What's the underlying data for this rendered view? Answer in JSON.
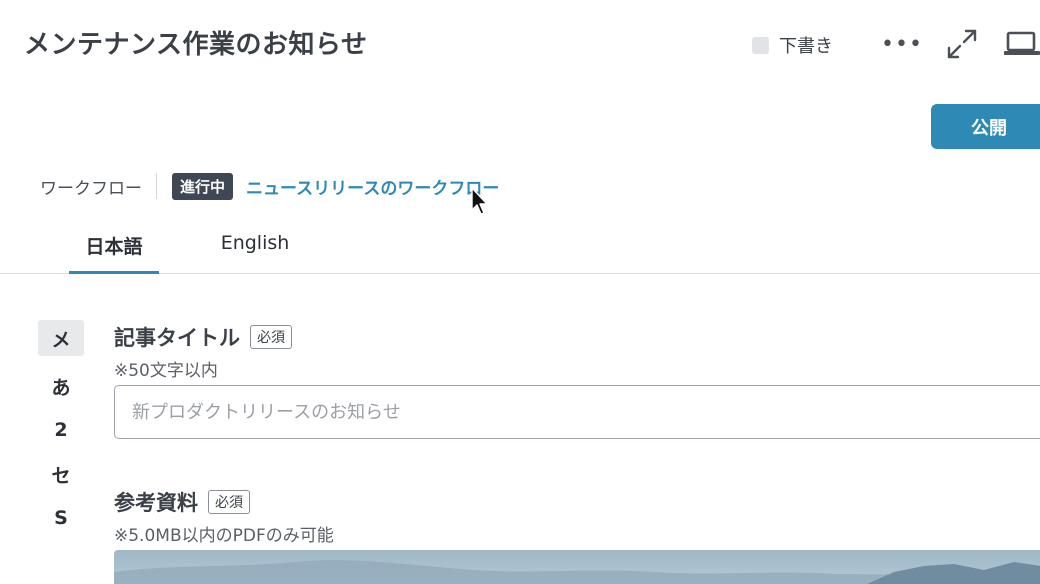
{
  "header": {
    "title": "メンテナンス作業のお知らせ",
    "status_label": "下書き",
    "more_label": "•••",
    "publish_label": "公開"
  },
  "workflow": {
    "label": "ワークフロー",
    "badge": "進行中",
    "link": "ニュースリリースのワークフロー"
  },
  "tabs": [
    {
      "label": "日本語",
      "active": true
    },
    {
      "label": "English",
      "active": false
    }
  ],
  "field_nav": [
    {
      "label": "メ",
      "active": true
    },
    {
      "label": "あ",
      "active": false
    },
    {
      "label": "2",
      "active": false
    },
    {
      "label": "セ",
      "active": false
    },
    {
      "label": "S",
      "active": false
    }
  ],
  "fields": {
    "title": {
      "label": "記事タイトル",
      "required": "必須",
      "hint": "※50文字以内",
      "value": "",
      "placeholder": "新プロダクトリリースのお知らせ"
    },
    "reference": {
      "label": "参考資料",
      "required": "必須",
      "hint": "※5.0MB以内のPDFのみ可能"
    }
  },
  "colors": {
    "accent": "#2e8ab5",
    "badge_bg": "#3f4654",
    "text": "#3a3f48"
  },
  "icons": [
    "more-icon",
    "expand-icon",
    "laptop-icon",
    "mouse-cursor-icon"
  ]
}
